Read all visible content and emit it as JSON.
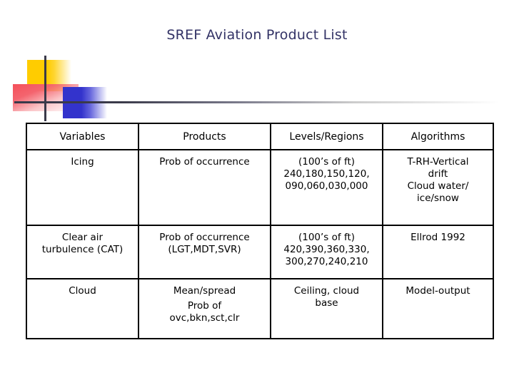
{
  "slide": {
    "title": "SREF Aviation Product List",
    "title_color": "#333366",
    "decoration": {
      "yellow_color": "#ffcc00",
      "red_color": "#f4505a",
      "blue_color": "#3333cc",
      "line_color": "#3a3a4a"
    }
  },
  "table": {
    "headers": {
      "variables": "Variables",
      "products": "Products",
      "levels": "Levels/Regions",
      "algorithms": "Algorithms"
    },
    "rows": [
      {
        "variables": "Icing",
        "products": "Prob of occurrence",
        "levels_line1": "(100’s of ft)",
        "levels_line2": "240,180,150,120,",
        "levels_line3": "090,060,030,000",
        "algorithms_line1": "T-RH-Vertical",
        "algorithms_line2": "drift",
        "algorithms_line3": "Cloud water/",
        "algorithms_line4": "ice/snow"
      },
      {
        "variables_line1": "Clear air",
        "variables_line2": "turbulence (CAT)",
        "products_line1": "Prob of occurrence",
        "products_line2": "(LGT,MDT,SVR)",
        "levels_line1": "(100’s of ft)",
        "levels_line2": "420,390,360,330,",
        "levels_line3": "300,270,240,210",
        "algorithms": "Ellrod 1992"
      },
      {
        "variables": "Cloud",
        "products_line1": "Mean/spread",
        "products_line2": "Prob of",
        "products_line3": "ovc,bkn,sct,clr",
        "levels_line1": "Ceiling, cloud",
        "levels_line2": "base",
        "algorithms": "Model-output"
      }
    ]
  }
}
